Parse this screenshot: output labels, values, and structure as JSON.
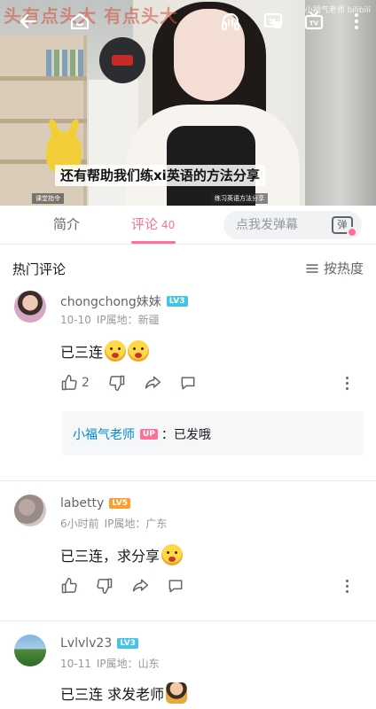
{
  "video": {
    "subtitle": "还有帮助我们练xi英语的方法分享",
    "overlay_title": "头有点头大 有点头大",
    "label_left": "课堂指令",
    "label_right": "练习英语方法分享",
    "watermark": "小福气老师 bilibili",
    "toolbar": {
      "back": "back-arrow-icon",
      "home": "home-icon",
      "listen": "headphones-icon",
      "cast": "cast-screen-icon",
      "tv": "tv-icon",
      "more": "more-vertical-icon"
    }
  },
  "tabs": {
    "intro": "简介",
    "comments": "评论",
    "comments_count": "40",
    "danmaku_placeholder": "点我发弹幕",
    "danmaku_button": "弹"
  },
  "comments_header": {
    "title": "热门评论",
    "sort": "按热度"
  },
  "comments": [
    {
      "user": "chongchong妹妹",
      "level": "LV3",
      "date": "10-10",
      "ip": "IP属地：新疆",
      "text": "已三连",
      "emojis": 2,
      "likes": "2",
      "reply": {
        "user": "小福气老师",
        "badge": "UP",
        "text": "：已发哦"
      }
    },
    {
      "user": "labetty",
      "level": "LV5",
      "date": "6小时前",
      "ip": "IP属地：广东",
      "text": "已三连，求分享",
      "emojis": 1,
      "likes": ""
    },
    {
      "user": "Lvlvlv23",
      "level": "LV3",
      "date": "10-11",
      "ip": "IP属地：山东",
      "text": "已三连 求发老师",
      "emojis": 1,
      "likes": ""
    }
  ],
  "colors": {
    "accent": "#fb7299",
    "lv3": "#42c5e5",
    "lv5": "#ff9d2a",
    "reply_name": "#008ac5"
  }
}
